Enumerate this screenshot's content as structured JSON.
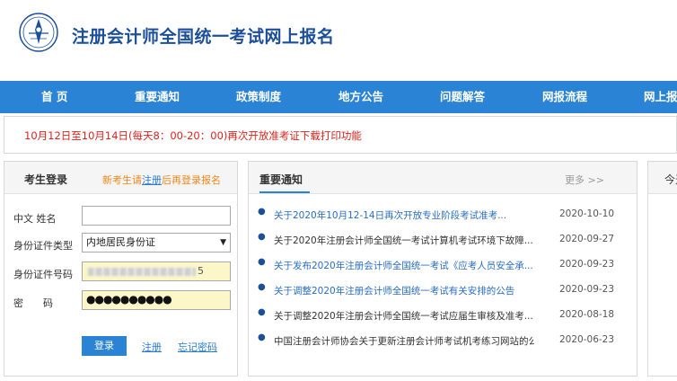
{
  "header": {
    "site_title": "注册会计师全国统一考试网上报名"
  },
  "nav": {
    "items": [
      {
        "label": "首 页"
      },
      {
        "label": "重要通知"
      },
      {
        "label": "政策制度"
      },
      {
        "label": "地方公告"
      },
      {
        "label": "问题解答"
      },
      {
        "label": "网报流程"
      },
      {
        "label": "网上报"
      }
    ]
  },
  "notice": {
    "text": "10月12日至10月14日(每天8：00-20：00)再次开放准考证下载打印功能"
  },
  "login": {
    "title": "考生登录",
    "hint_prefix": "新考生请",
    "hint_link": "注册",
    "hint_suffix": "后再登录报名",
    "name_label": "中文 姓名",
    "id_type_label": "身份证件类型",
    "id_type_value": "内地居民身份证",
    "id_number_label": "身份证件号码",
    "id_number_visible_tail": "5",
    "password_label": "密　　码",
    "password_value": "●●●●●●●●●●",
    "login_button": "登录",
    "register_link": "注册",
    "forgot_link": "忘记密码"
  },
  "news": {
    "title": "重要通知",
    "more": "更多 >>",
    "items": [
      {
        "title": "关于2020年10月12-14日再次开放专业阶段考试准考...",
        "date": "2020-10-10"
      },
      {
        "title": "关于2020年注册会计师全国统一考试计算机考试环境下故障...",
        "date": "2020-09-27"
      },
      {
        "title": "关于发布2020年注册会计师全国统一考试《应考人员安全承...",
        "date": "2020-09-23"
      },
      {
        "title": "关于调整2020年注册会计师全国统一考试有关安排的公告",
        "date": "2020-09-23"
      },
      {
        "title": "关于调整2020年注册会计师全国统一考试应届生审核及准考...",
        "date": "2020-08-18"
      },
      {
        "title": "中国注册会计师协会关于更新注册会计师考试机考练习网站的公...",
        "date": "2020-06-23"
      }
    ]
  },
  "third_panel": {
    "title": "今天"
  },
  "colors": {
    "brand_blue": "#2a83d4",
    "title_blue": "#1c4f9a",
    "notice_red": "#d9241c",
    "hint_orange": "#f08519"
  }
}
